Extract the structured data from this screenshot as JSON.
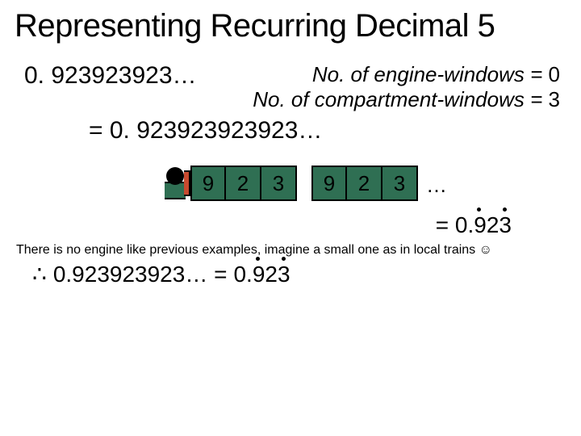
{
  "title": "Representing Recurring Decimal 5",
  "decimal_short": "0. 923923923…",
  "info": {
    "line1_label": "No. of engine-windows =",
    "line1_value": "0",
    "line2_label": "No. of compartment-windows =",
    "line2_value": "3"
  },
  "extended": "= 0. 923923923923…",
  "train": {
    "car1": [
      "9",
      "2",
      "3"
    ],
    "car2": [
      "9",
      "2",
      "3"
    ],
    "trailing": "…"
  },
  "result": {
    "prefix": "= 0.",
    "digits": "923"
  },
  "note": "There is no engine like previous examples, imagine a small one as in local trains ☺",
  "conclusion": {
    "symbol": "∴",
    "lhs": "0.923923923… =",
    "prefix": "0.",
    "digits": "923"
  }
}
